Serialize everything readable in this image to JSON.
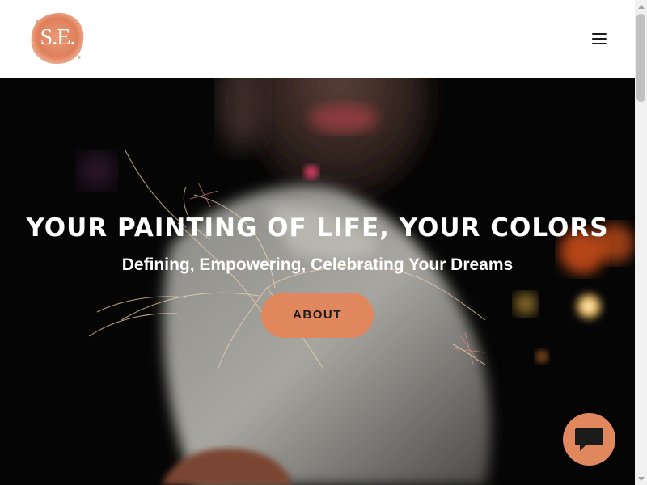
{
  "header": {
    "logo_text": "S.E.",
    "menu_icon": "hamburger-menu-icon"
  },
  "hero": {
    "title": "YOUR PAINTING OF LIFE, YOUR COLORS",
    "subtitle": "Defining, Empowering, Celebrating Your Dreams",
    "cta_label": "ABOUT"
  },
  "chat": {
    "icon": "chat-bubble-icon"
  },
  "colors": {
    "accent": "#e1875d",
    "header_bg": "#ffffff",
    "hero_text": "#ffffff"
  }
}
